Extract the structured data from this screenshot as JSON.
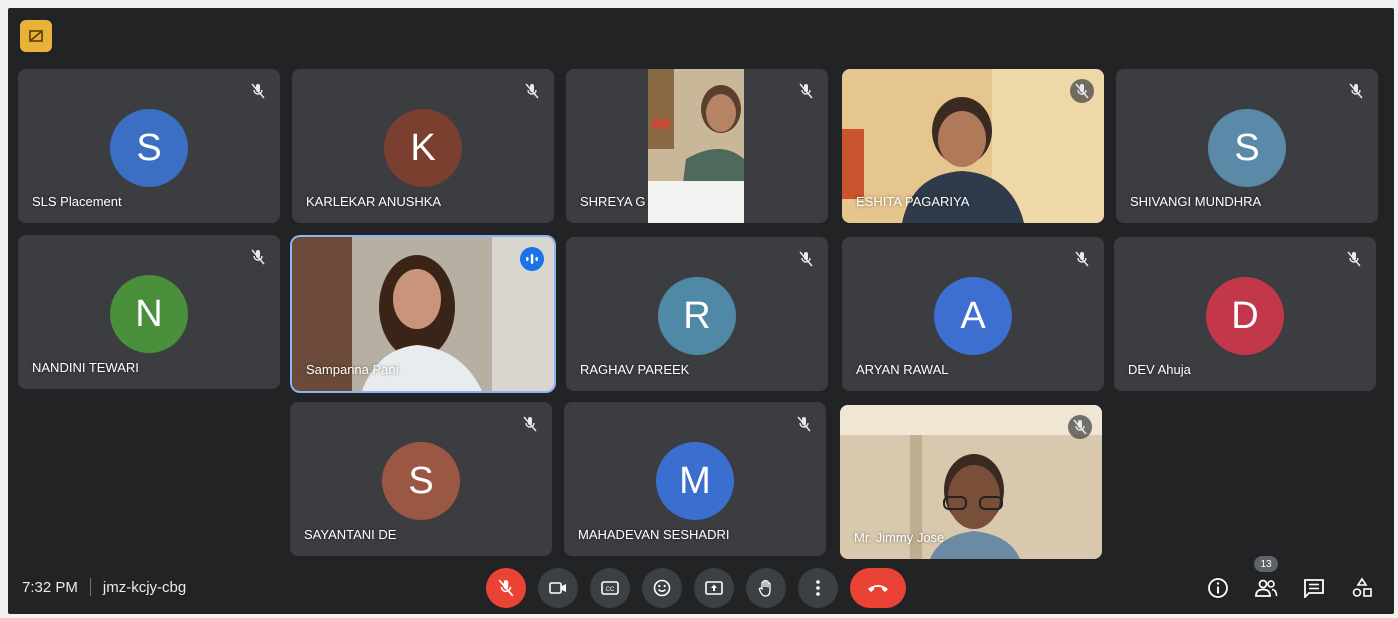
{
  "meeting": {
    "time": "7:32 PM",
    "code": "jmz-kcjy-cbg",
    "participant_count": "13"
  },
  "participants": {
    "sls": {
      "name": "SLS Placement",
      "initial": "S",
      "color": "#3a6fc4"
    },
    "karlekar": {
      "name": "KARLEKAR ANUSHKA",
      "initial": "K",
      "color": "#7b3f2f"
    },
    "shreya": {
      "name": "SHREYA G"
    },
    "eshita": {
      "name": "ESHITA PAGARIYA"
    },
    "shivangi": {
      "name": "SHIVANGI MUNDHRA",
      "initial": "S",
      "color": "#5a8aa8"
    },
    "nandini": {
      "name": "NANDINI TEWARI",
      "initial": "N",
      "color": "#4a8f3c"
    },
    "sampanna": {
      "name": "Sampanna Pani"
    },
    "raghav": {
      "name": "RAGHAV PAREEK",
      "initial": "R",
      "color": "#4f89a6"
    },
    "aryan": {
      "name": "ARYAN RAWAL",
      "initial": "A",
      "color": "#3d6fd0"
    },
    "dev": {
      "name": "DEV Ahuja",
      "initial": "D",
      "color": "#c2374a"
    },
    "sayantani": {
      "name": "SAYANTANI DE",
      "initial": "S",
      "color": "#9a5844"
    },
    "mahadevan": {
      "name": "MAHADEVAN SESHADRI",
      "initial": "M",
      "color": "#3a6fd0"
    },
    "jimmy": {
      "name": "Mr. Jimmy Jose"
    }
  },
  "icons": {
    "recording": "recording-icon",
    "mic_off": "mic-off-icon",
    "camera": "camera-icon",
    "captions": "captions-icon",
    "emoji": "emoji-icon",
    "present": "present-icon",
    "hand": "raise-hand-icon",
    "more": "more-icon",
    "end_call": "end-call-icon",
    "info": "info-icon",
    "people": "people-icon",
    "chat": "chat-icon",
    "activities": "activities-icon"
  }
}
